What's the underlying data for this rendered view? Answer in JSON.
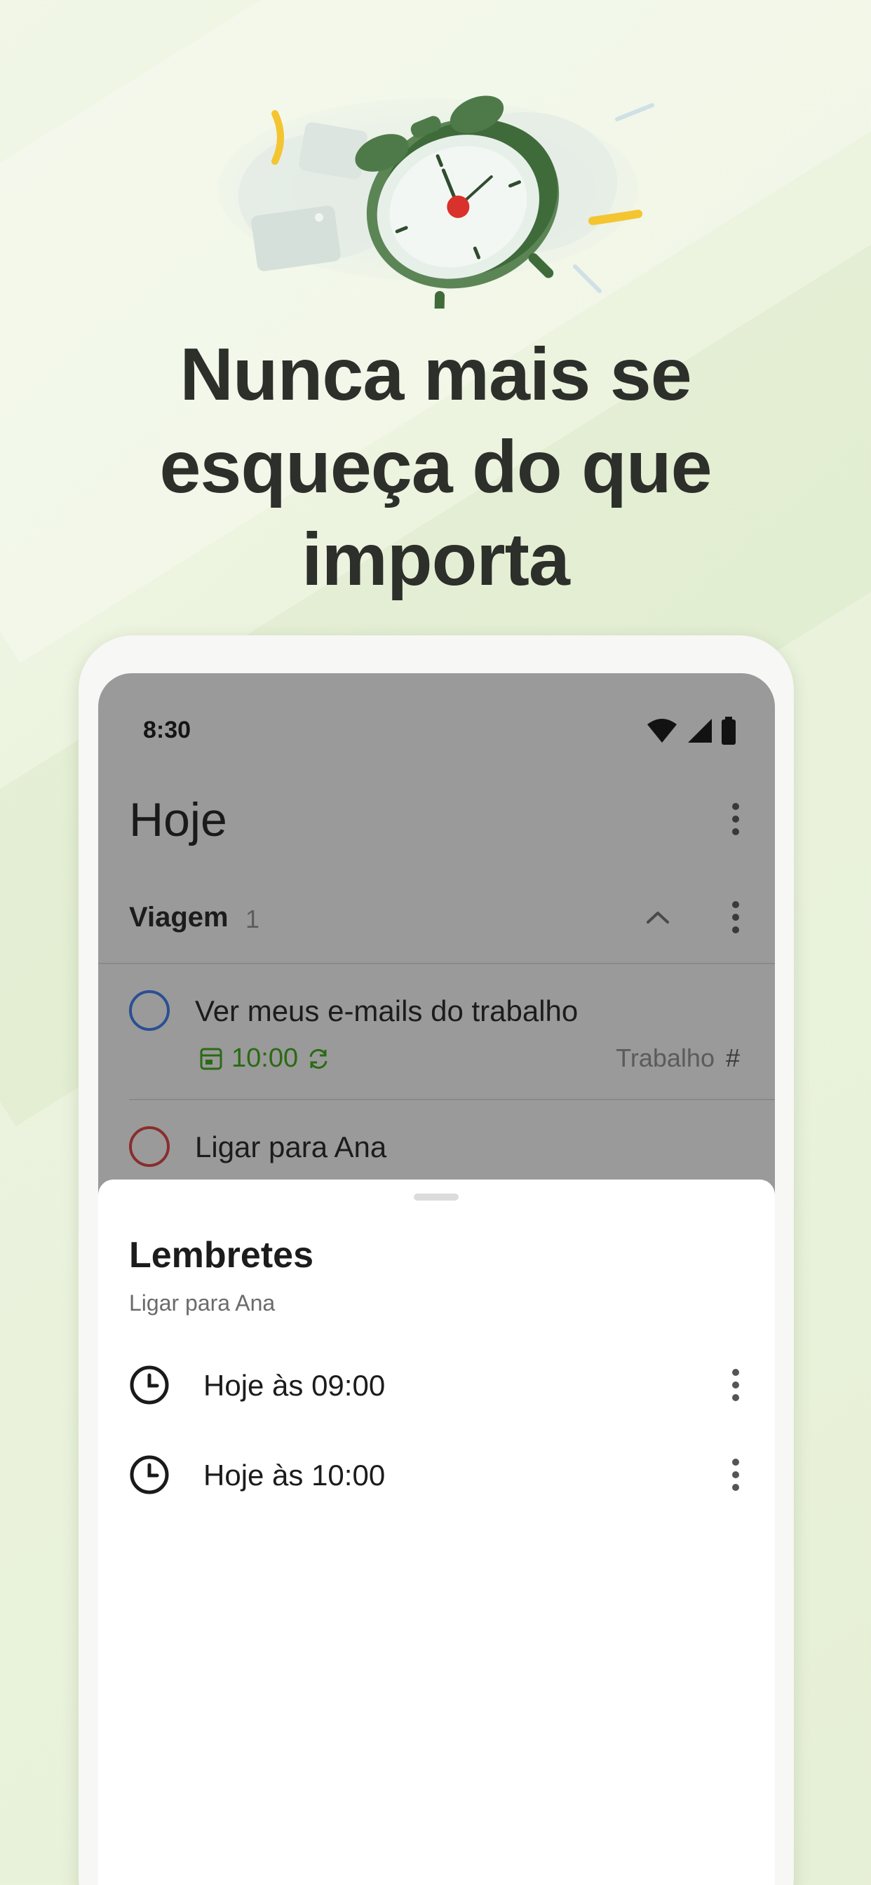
{
  "headline": [
    "Nunca mais se",
    "esqueça do que",
    "importa"
  ],
  "phone": {
    "status_time": "8:30",
    "screen_title": "Hoje",
    "section": {
      "name": "Viagem",
      "count": "1"
    },
    "tasks": [
      {
        "label": "Ver meus e-mails do trabalho",
        "circle_color": "#2b4f93",
        "due_time": "10:00",
        "project": "Trabalho",
        "project_symbol": "#"
      },
      {
        "label": "Ligar para Ana",
        "circle_color": "#8a2d2d"
      }
    ],
    "sheet": {
      "title": "Lembretes",
      "subtitle": "Ligar para Ana",
      "reminders": [
        {
          "label": "Hoje às 09:00"
        },
        {
          "label": "Hoje às 10:00"
        }
      ]
    }
  },
  "colors": {
    "background": "#ebf3de",
    "dim_overlay": "#9a9a9a",
    "due_green": "#2b6a14",
    "clock_green": "#3f6b3b",
    "clock_red": "#d9312b",
    "accent_yellow": "#f4c531"
  }
}
